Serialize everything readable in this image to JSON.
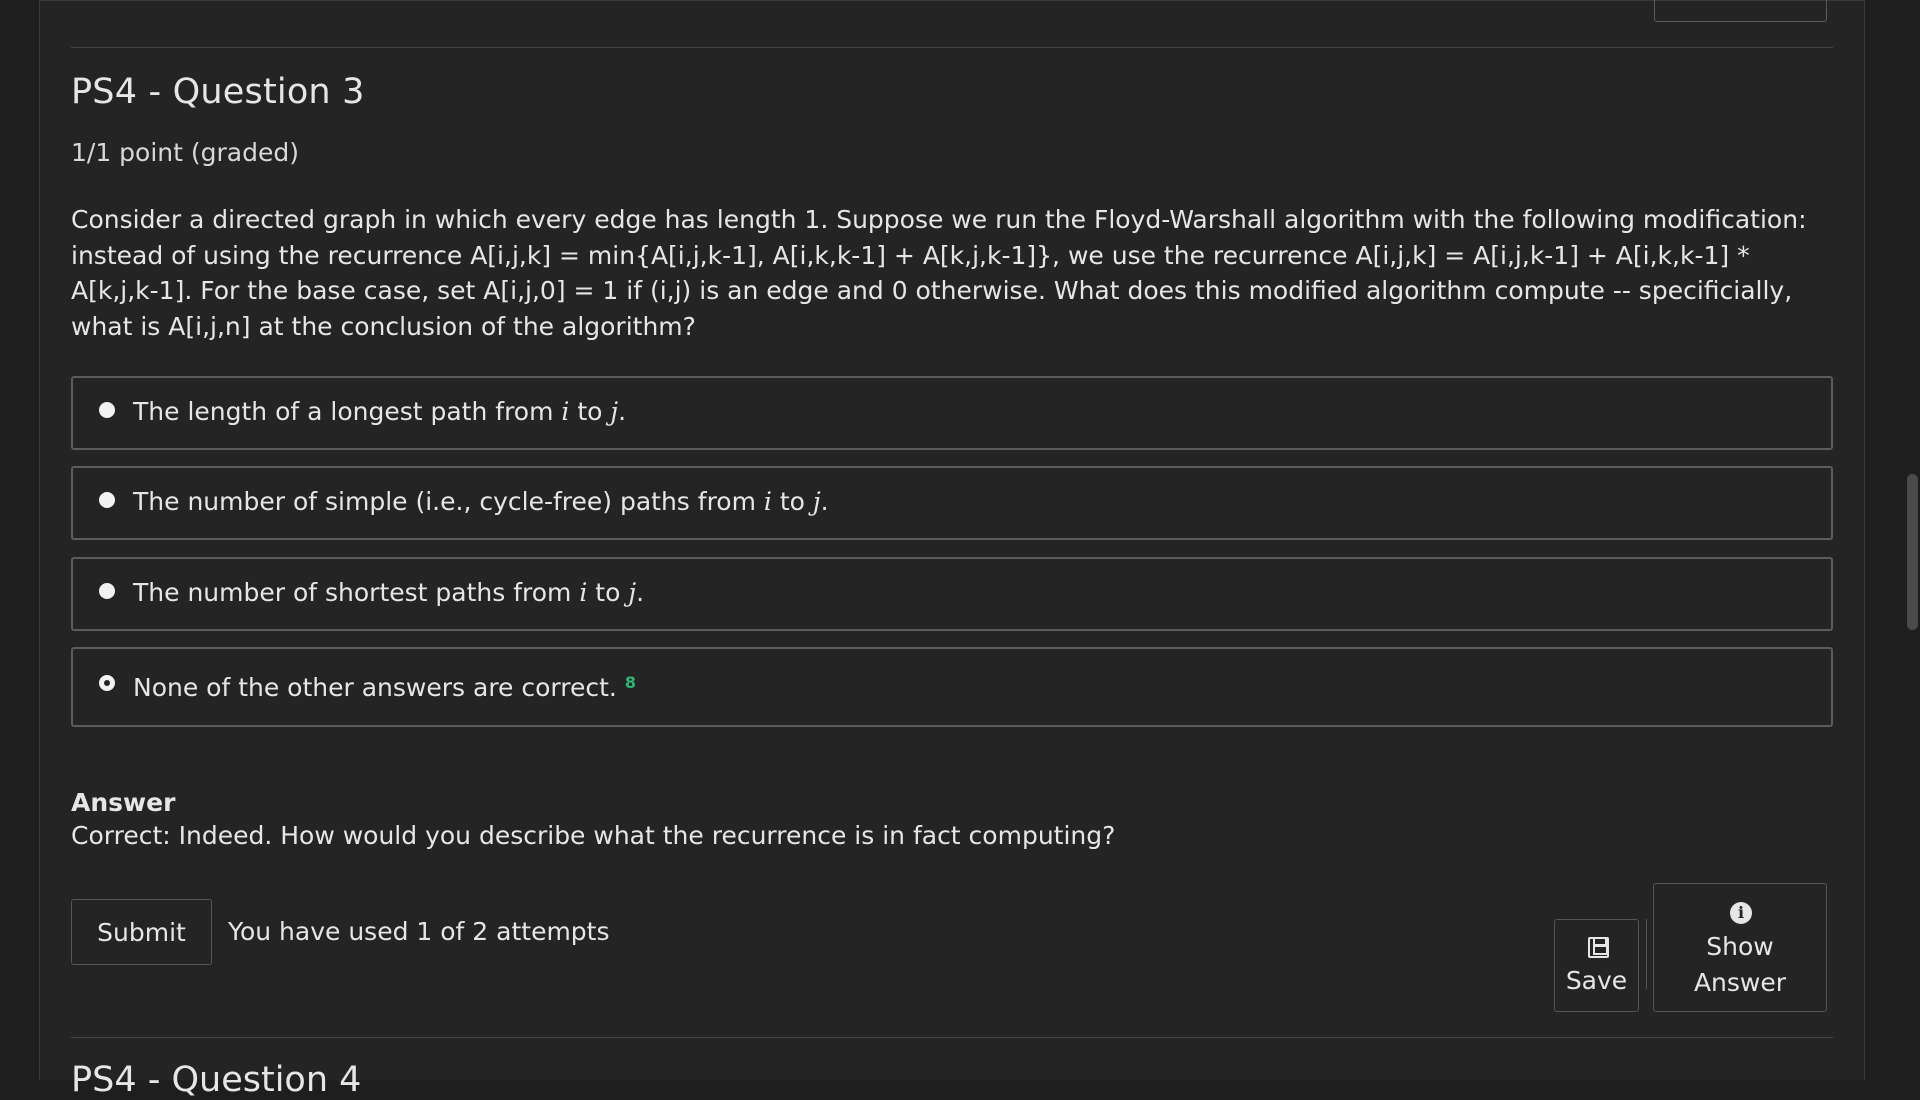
{
  "question": {
    "title": "PS4 - Question 3",
    "points": "1/1 point (graded)",
    "text": "Consider a directed graph in which every edge has length 1. Suppose we run the Floyd-Warshall algorithm with the following modification: instead of using the recurrence A[i,j,k] = min{A[i,j,k-1], A[i,k,k-1] + A[k,j,k-1]}, we use the recurrence A[i,j,k] = A[i,j,k-1] + A[i,k,k-1] * A[k,j,k-1]. For the base case, set A[i,j,0] = 1 if (i,j) is an edge and 0 otherwise. What does this modified algorithm compute -- specificially, what is A[i,j,n] at the conclusion of the algorithm?",
    "options": [
      {
        "prefix": "The length of a longest path from ",
        "var1": "i",
        "mid": " to ",
        "var2": "j",
        "suffix": ".",
        "selected": false
      },
      {
        "prefix": "The number of simple (i.e., cycle-free) paths from ",
        "var1": "i",
        "mid": " to ",
        "var2": "j",
        "suffix": ".",
        "selected": false
      },
      {
        "prefix": "The number of shortest paths from ",
        "var1": "i",
        "mid": " to ",
        "var2": "j",
        "suffix": ".",
        "selected": false
      },
      {
        "text": "None of the other answers are correct.",
        "selected": true,
        "mark": "8"
      }
    ]
  },
  "answer": {
    "heading": "Answer",
    "text": "Correct:  Indeed. How would you describe what the recurrence is in fact computing?"
  },
  "actions": {
    "submit_label": "Submit",
    "attempts_text": "You have used 1 of 2 attempts",
    "save_label": "Save",
    "show_answer_line1": "Show",
    "show_answer_line2": "Answer"
  },
  "next_question": {
    "title": "PS4 - Question 4"
  },
  "colors": {
    "background": "#1e1e1e",
    "panel": "#242424",
    "text": "#e6e6e6",
    "border": "#5c5c5c",
    "correct": "#2bb673"
  }
}
